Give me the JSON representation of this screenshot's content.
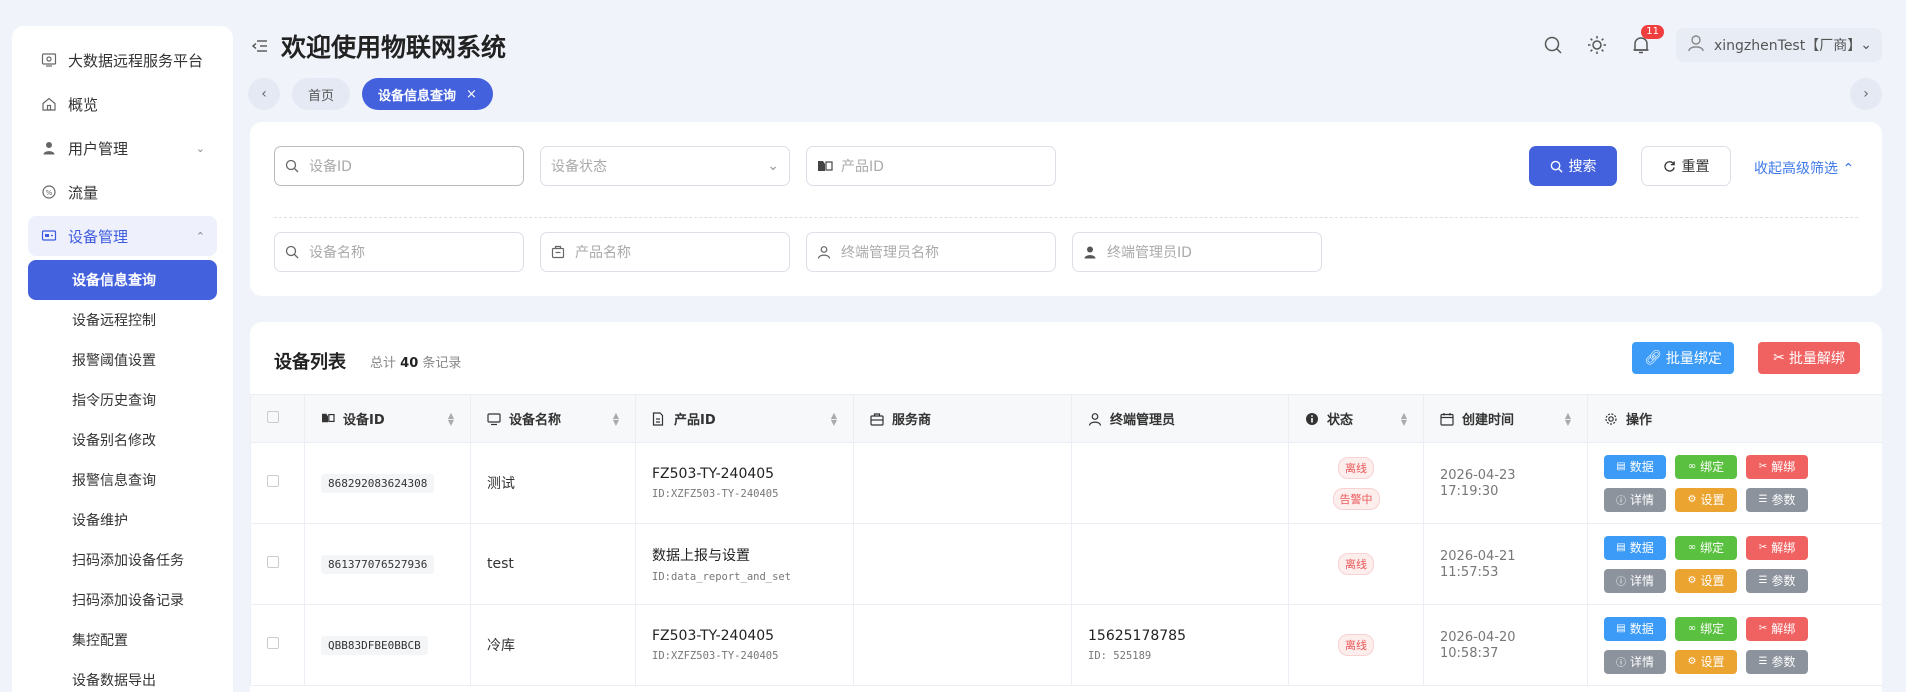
{
  "sidebar": {
    "items": [
      {
        "label": "大数据远程服务平台",
        "icon": "platform-icon"
      },
      {
        "label": "概览",
        "icon": "home-icon"
      },
      {
        "label": "用户管理",
        "icon": "user-icon"
      },
      {
        "label": "流量",
        "icon": "traffic-icon"
      },
      {
        "label": "设备管理",
        "icon": "device-icon"
      }
    ],
    "sub_items": [
      "设备信息查询",
      "设备远程控制",
      "报警阈值设置",
      "指令历史查询",
      "设备别名修改",
      "报警信息查询",
      "设备维护",
      "扫码添加设备任务",
      "扫码添加设备记录",
      "集控配置",
      "设备数据导出"
    ]
  },
  "header": {
    "title": "欢迎使用物联网系统",
    "notification_count": "11",
    "user": "xingzhenTest【厂商】"
  },
  "tabs": [
    {
      "label": "首页"
    },
    {
      "label": "设备信息查询"
    }
  ],
  "filter": {
    "device_id_placeholder": "设备ID",
    "device_status_placeholder": "设备状态",
    "product_id_placeholder": "产品ID",
    "device_name_placeholder": "设备名称",
    "product_name_placeholder": "产品名称",
    "manager_name_placeholder": "终端管理员名称",
    "manager_id_placeholder": "终端管理员ID",
    "search_label": "搜索",
    "reset_label": "重置",
    "collapse_label": "收起高级筛选"
  },
  "table": {
    "title": "设备列表",
    "count_prefix": "总计",
    "count": "40",
    "count_suffix": "条记录",
    "bind_label": "批量绑定",
    "unbind_label": "批量解绑",
    "headers": [
      "设备ID",
      "设备名称",
      "产品ID",
      "服务商",
      "终端管理员",
      "状态",
      "创建时间",
      "操作"
    ],
    "op_labels": {
      "data": "数据",
      "bind": "绑定",
      "unbind": "解绑",
      "detail": "详情",
      "settings": "设置",
      "params": "参数"
    },
    "rows": [
      {
        "device_id": "868292083624308",
        "device_name": "测试",
        "product_main": "FZ503-TY-240405",
        "product_sub": "ID:XZFZ503-TY-240405",
        "provider": "",
        "manager_main": "",
        "manager_sub": "",
        "status": "离线",
        "alarm": "告警中",
        "created": "2026-04-23 17:19:30"
      },
      {
        "device_id": "861377076527936",
        "device_name": "test",
        "product_main": "数据上报与设置",
        "product_sub": "ID:data_report_and_set",
        "provider": "",
        "manager_main": "",
        "manager_sub": "",
        "status": "离线",
        "alarm": "",
        "created": "2026-04-21 11:57:53"
      },
      {
        "device_id": "QBB83DFBE0BBCB",
        "device_name": "冷库",
        "product_main": "FZ503-TY-240405",
        "product_sub": "ID:XZFZ503-TY-240405",
        "provider": "",
        "manager_main": "15625178785",
        "manager_sub": "ID: 525189",
        "status": "离线",
        "alarm": "",
        "created": "2026-04-20 10:58:37"
      }
    ]
  },
  "colors": {
    "primary": "#4361dd",
    "blue": "#3b9bf6",
    "green": "#59c13f",
    "red": "#f06262",
    "orange": "#eca431",
    "gray": "#8c939d"
  }
}
